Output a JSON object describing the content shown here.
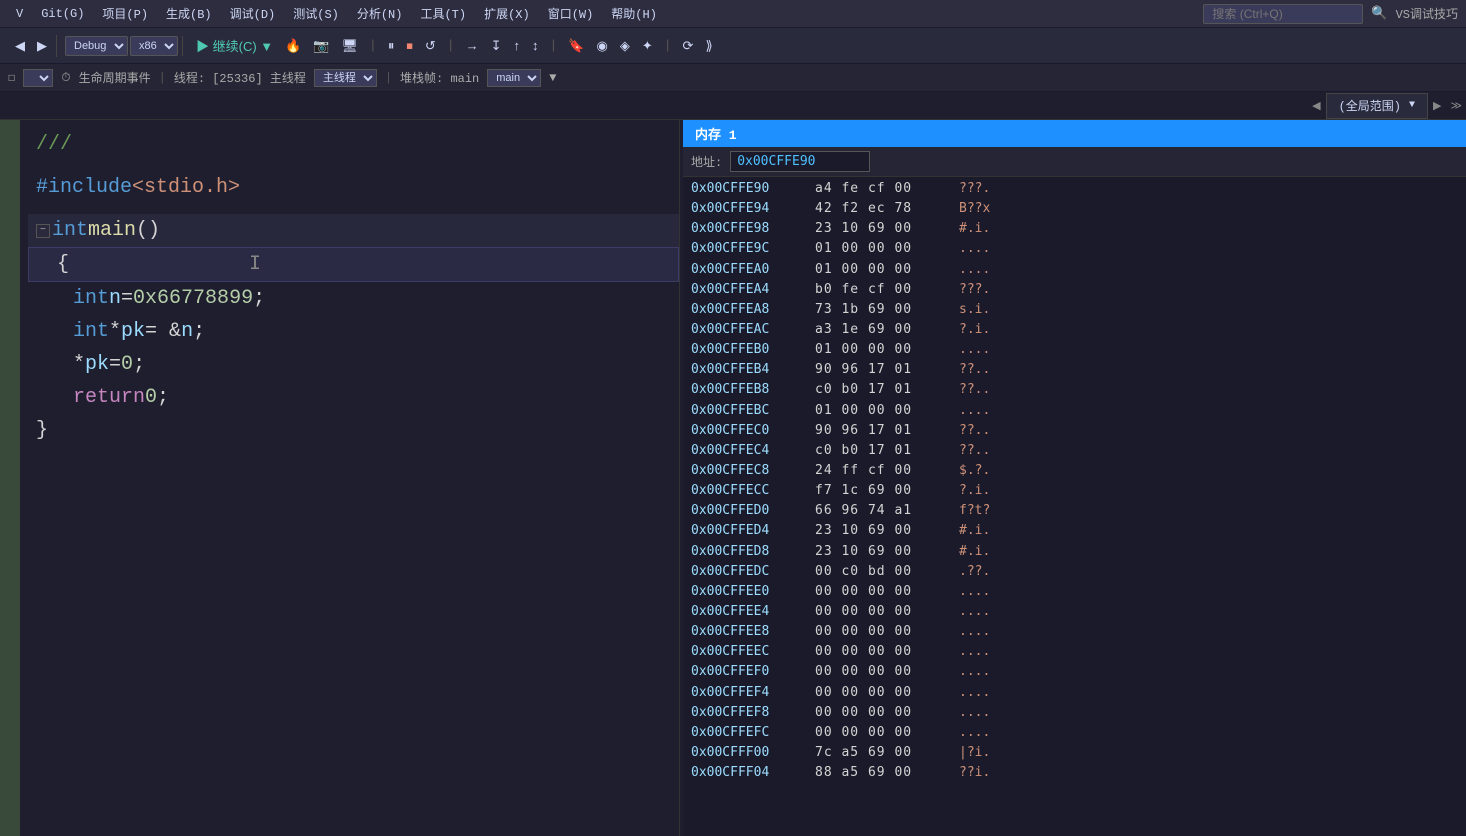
{
  "menubar": {
    "items": [
      {
        "label": "Git(G)",
        "id": "menu-git"
      },
      {
        "label": "项目(P)",
        "id": "menu-project"
      },
      {
        "label": "生成(B)",
        "id": "menu-build"
      },
      {
        "label": "调试(D)",
        "id": "menu-debug"
      },
      {
        "label": "测试(S)",
        "id": "menu-test"
      },
      {
        "label": "分析(N)",
        "id": "menu-analyze"
      },
      {
        "label": "工具(T)",
        "id": "menu-tools"
      },
      {
        "label": "扩展(X)",
        "id": "menu-extend"
      },
      {
        "label": "窗口(W)",
        "id": "menu-window"
      },
      {
        "label": "帮助(H)",
        "id": "menu-help"
      }
    ],
    "search_placeholder": "搜索 (Ctrl+Q)",
    "vs_tip": "VS调试技巧"
  },
  "toolbar": {
    "config": "Debug",
    "platform": "x86",
    "continue_label": "继续(C) ▶",
    "buttons": [
      "◀◀",
      "▶",
      "🔥",
      "⏹",
      "⏸",
      "▶|",
      "↺",
      "→",
      "↧",
      "↙",
      "↕",
      "🔖",
      "◉",
      "◈",
      "✦"
    ]
  },
  "debugbar": {
    "lifecycle_label": "生命周期事件",
    "thread_label": "线程: [25336] 主线程",
    "stack_label": "堆栈帧: main"
  },
  "tabbar": {
    "scope_label": "(全局范围)"
  },
  "code": {
    "lines": [
      {
        "num": "",
        "content": "///",
        "type": "comment"
      },
      {
        "num": "",
        "content": "",
        "type": "blank"
      },
      {
        "num": "",
        "content": "#include <stdio.h>",
        "type": "include"
      },
      {
        "num": "",
        "content": "",
        "type": "blank"
      },
      {
        "num": "",
        "content": "int main()",
        "type": "function_decl"
      },
      {
        "num": "",
        "content": "{",
        "type": "brace_open"
      },
      {
        "num": "",
        "content": "    int n = 0x66778899;",
        "type": "code"
      },
      {
        "num": "",
        "content": "    int* pk = &n;",
        "type": "code"
      },
      {
        "num": "",
        "content": "    *pk = 0;",
        "type": "code"
      },
      {
        "num": "",
        "content": "    return 0;",
        "type": "code"
      },
      {
        "num": "",
        "content": "}",
        "type": "brace_close"
      }
    ]
  },
  "memory": {
    "title": "内存 1",
    "address_label": "地址:",
    "address_value": "0x00CFFE90",
    "rows": [
      {
        "addr": "0x00CFFE90",
        "bytes": "a4 fe cf 00",
        "chars": "???."
      },
      {
        "addr": "0x00CFFE94",
        "bytes": "42 f2 ec 78",
        "chars": "B??x"
      },
      {
        "addr": "0x00CFFE98",
        "bytes": "23 10 69 00",
        "chars": "#.i."
      },
      {
        "addr": "0x00CFFE9C",
        "bytes": "01 00 00 00",
        "chars": "...."
      },
      {
        "addr": "0x00CFFEА0",
        "bytes": "01 00 00 00",
        "chars": "...."
      },
      {
        "addr": "0x00CFFEA4",
        "bytes": "b0 fe cf 00",
        "chars": "???."
      },
      {
        "addr": "0x00CFFEА8",
        "bytes": "73 1b 69 00",
        "chars": "s.i."
      },
      {
        "addr": "0x00CFFEAC",
        "bytes": "a3 1e 69 00",
        "chars": "?.i."
      },
      {
        "addr": "0x00CFFEB0",
        "bytes": "01 00 00 00",
        "chars": "...."
      },
      {
        "addr": "0x00CFFEB4",
        "bytes": "90 96 17 01",
        "chars": "??.."
      },
      {
        "addr": "0x00CFFEB8",
        "bytes": "c0 b0 17 01",
        "chars": "??.."
      },
      {
        "addr": "0x00CFFEBC",
        "bytes": "01 00 00 00",
        "chars": "...."
      },
      {
        "addr": "0x00CFFEC0",
        "bytes": "90 96 17 01",
        "chars": "??.."
      },
      {
        "addr": "0x00CFFEC4",
        "bytes": "c0 b0 17 01",
        "chars": "??.."
      },
      {
        "addr": "0x00CFFEC8",
        "bytes": "24 ff cf 00",
        "chars": "$.?."
      },
      {
        "addr": "0x00CFFECC",
        "bytes": "f7 1c 69 00",
        "chars": "?.i."
      },
      {
        "addr": "0x00CFFED0",
        "bytes": "66 96 74 a1",
        "chars": "f?t?"
      },
      {
        "addr": "0x00CFFED4",
        "bytes": "23 10 69 00",
        "chars": "#.i."
      },
      {
        "addr": "0x00CFFED8",
        "bytes": "23 10 69 00",
        "chars": "#.i."
      },
      {
        "addr": "0x00CFFEDC",
        "bytes": "00 c0 bd 00",
        "chars": ".??."
      },
      {
        "addr": "0x00CFFEE0",
        "bytes": "00 00 00 00",
        "chars": "...."
      },
      {
        "addr": "0x00CFFEE4",
        "bytes": "00 00 00 00",
        "chars": "...."
      },
      {
        "addr": "0x00CFFEE8",
        "bytes": "00 00 00 00",
        "chars": "...."
      },
      {
        "addr": "0x00CFFEEC",
        "bytes": "00 00 00 00",
        "chars": "...."
      },
      {
        "addr": "0x00CFFEF0",
        "bytes": "00 00 00 00",
        "chars": "...."
      },
      {
        "addr": "0x00CFFEF4",
        "bytes": "00 00 00 00",
        "chars": "...."
      },
      {
        "addr": "0x00CFFEF8",
        "bytes": "00 00 00 00",
        "chars": "...."
      },
      {
        "addr": "0x00CFFEFC",
        "bytes": "00 00 00 00",
        "chars": "...."
      },
      {
        "addr": "0x00CFFF00",
        "bytes": "7c a5 69 00",
        "chars": "|?i."
      },
      {
        "addr": "0x00CFFF04",
        "bytes": "88 a5 69 00",
        "chars": "??i."
      }
    ]
  }
}
